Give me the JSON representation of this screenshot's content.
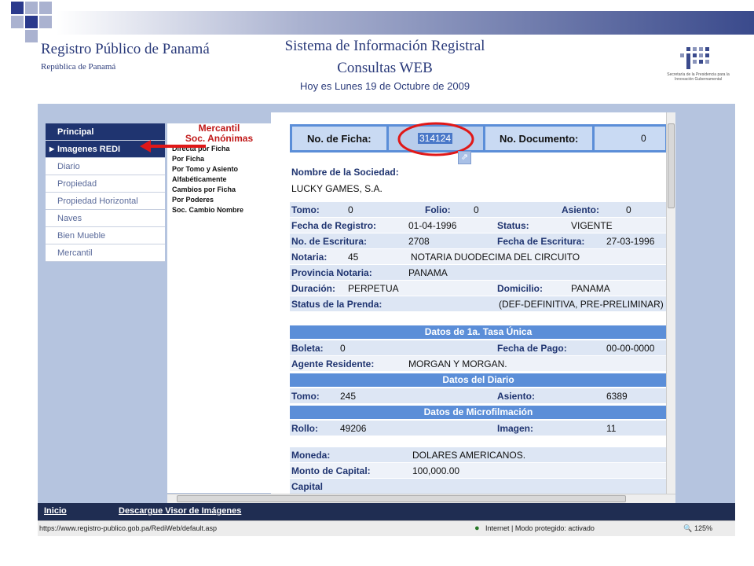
{
  "header": {
    "org_title": "Registro Público de Panamá",
    "org_subtitle": "República de Panamá",
    "system_title": "Sistema de Información Registral",
    "system_subtitle": "Consultas WEB",
    "date_line": "Hoy es Lunes 19 de Octubre de 2009",
    "logo_text": "Secretaría de la Presidencia para la Innovación Gubernamental"
  },
  "nav": {
    "items": [
      {
        "label": "Principal"
      },
      {
        "label": "Imagenes REDI"
      },
      {
        "label": "Diario"
      },
      {
        "label": "Propiedad"
      },
      {
        "label": "Propiedad Horizontal"
      },
      {
        "label": "Naves"
      },
      {
        "label": "Bien Mueble"
      },
      {
        "label": "Mercantil"
      }
    ]
  },
  "submenu": {
    "title1": "Mercantil",
    "title2": "Soc. Anónimas",
    "links": [
      "Directa por Ficha",
      "Por Ficha",
      "Por Tomo y Asiento",
      "Alfabéticamente",
      "Cambios por Ficha",
      "Por Poderes",
      "Soc. Cambio Nombre"
    ]
  },
  "record": {
    "ficha_label": "No. de Ficha:",
    "ficha_value": "314124",
    "doc_label": "No. Documento:",
    "doc_value": "0",
    "sociedad_label": "Nombre de la Sociedad:",
    "sociedad_value": "LUCKY GAMES, S.A.",
    "tomo_label": "Tomo:",
    "tomo_value": "0",
    "folio_label": "Folio:",
    "folio_value": "0",
    "asiento_label": "Asiento:",
    "asiento_value": "0",
    "fecha_registro_label": "Fecha de Registro:",
    "fecha_registro_value": "01-04-1996",
    "status_label": "Status:",
    "status_value": "VIGENTE",
    "escritura_label": "No. de Escritura:",
    "escritura_value": "2708",
    "fecha_escritura_label": "Fecha de Escritura:",
    "fecha_escritura_value": "27-03-1996",
    "notaria_label": "Notaria:",
    "notaria_value": "45",
    "notaria_name": "NOTARIA DUODECIMA DEL CIRCUITO",
    "provincia_label": "Provincia Notaria:",
    "provincia_value": "PANAMA",
    "duracion_label": "Duración:",
    "duracion_value": "PERPETUA",
    "domicilio_label": "Domicilio:",
    "domicilio_value": "PANAMA",
    "prenda_label": "Status de la Prenda:",
    "prenda_value": "(DEF-DEFINITIVA, PRE-PRELIMINAR)",
    "tasa_header": "Datos de 1a. Tasa Única",
    "boleta_label": "Boleta:",
    "boleta_value": "0",
    "fecha_pago_label": "Fecha de Pago:",
    "fecha_pago_value": "00-00-0000",
    "agente_label": "Agente Residente:",
    "agente_value": "MORGAN Y MORGAN.",
    "diario_header": "Datos del Diario",
    "d_tomo_label": "Tomo:",
    "d_tomo_value": "245",
    "d_asiento_label": "Asiento:",
    "d_asiento_value": "6389",
    "micro_header": "Datos de Microfilmación",
    "rollo_label": "Rollo:",
    "rollo_value": "49206",
    "imagen_label": "Imagen:",
    "imagen_value": "11",
    "moneda_label": "Moneda:",
    "moneda_value": "DOLARES AMERICANOS.",
    "capital_label": "Monto de Capital:",
    "capital_value": "100,000.00",
    "capital2_label": "Capital"
  },
  "footer": {
    "inicio": "Inicio",
    "descargue": "Descargue Visor de Imágenes"
  },
  "statusbar": {
    "url": "https://www.registro-publico.gob.pa/RediWeb/default.asp",
    "zone": "Internet | Modo protegido: activado",
    "zoom": "125%"
  },
  "colors": {
    "nav_dark": "#1f3470",
    "section_blue": "#5b8ed8",
    "highlight_red": "#e01818"
  }
}
